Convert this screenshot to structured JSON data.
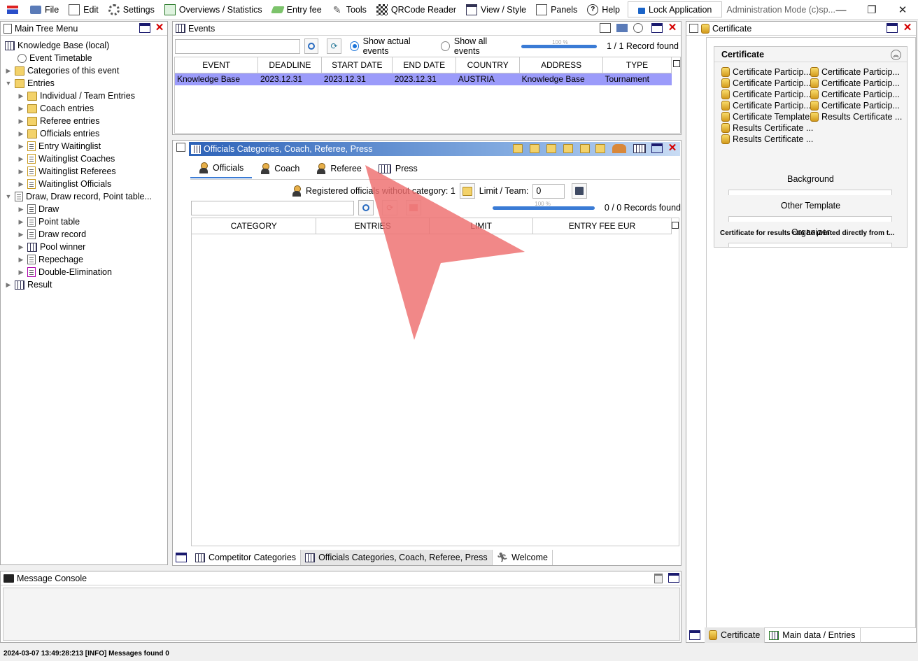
{
  "menubar": {
    "items": [
      "File",
      "Edit",
      "Settings",
      "Overviews / Statistics",
      "Entry fee",
      "Tools",
      "QRCode Reader",
      "View / Style",
      "Panels",
      "Help"
    ],
    "lock_label": "Lock Application",
    "admin_text": "Administration Mode (c)sp..."
  },
  "tree_panel": {
    "title": "Main Tree Menu",
    "items": [
      {
        "label": "Knowledge Base (local)"
      },
      {
        "label": "Event Timetable"
      },
      {
        "label": "Categories of this event"
      },
      {
        "label": "Entries"
      },
      {
        "label": "Individual / Team Entries"
      },
      {
        "label": "Coach entries"
      },
      {
        "label": "Referee entries"
      },
      {
        "label": "Officials entries"
      },
      {
        "label": "Entry Waitinglist"
      },
      {
        "label": "Waitinglist Coaches"
      },
      {
        "label": "Waitinglist Referees"
      },
      {
        "label": "Waitinglist Officials"
      },
      {
        "label": "Draw, Draw record, Point table..."
      },
      {
        "label": "Draw"
      },
      {
        "label": "Point table"
      },
      {
        "label": "Draw record"
      },
      {
        "label": "Pool winner"
      },
      {
        "label": "Repechage"
      },
      {
        "label": "Double-Elimination"
      },
      {
        "label": "Result"
      }
    ]
  },
  "events_panel": {
    "title": "Events",
    "search_value": "",
    "radio_actual": "Show actual events",
    "radio_all": "Show all events",
    "progress_text": "100 %",
    "progress": 1.0,
    "record_count": "1 / 1 Record found",
    "columns": [
      "EVENT",
      "DEADLINE",
      "START DATE",
      "END DATE",
      "COUNTRY",
      "ADDRESS",
      "TYPE"
    ],
    "rows": [
      [
        "Knowledge Base",
        "2023.12.31",
        "2023.12.31",
        "2023.12.31",
        "AUSTRIA",
        "Knowledge Base",
        "Tournament"
      ]
    ]
  },
  "officials_panel": {
    "title": "Officials Categories, Coach, Referee, Press",
    "tabs": [
      "Officials",
      "Coach",
      "Referee",
      "Press"
    ],
    "registered_text": "Registered officials without category: 1",
    "limit_label": "Limit / Team:",
    "limit_value": "0",
    "search_value": "",
    "progress_text": "100 %",
    "progress": 1.0,
    "record_count": "0 / 0 Records found",
    "columns": [
      "CATEGORY",
      "ENTRIES",
      "LIMIT",
      "ENTRY FEE EUR"
    ],
    "bottom_tabs": [
      "Competitor Categories",
      "Officials Categories, Coach, Referee, Press",
      "Welcome"
    ]
  },
  "certificate_panel": {
    "title": "Certificate",
    "section_title": "Certificate",
    "items_left": [
      "Certificate Particip...",
      "Certificate Particip...",
      "Certificate Particip...",
      "Certificate Particip...",
      "Certificate Template",
      "Results Certificate ...",
      "Results Certificate ..."
    ],
    "items_right": [
      "Certificate Particip...",
      "Certificate Particip...",
      "Certificate Particip...",
      "Certificate Particip...",
      "Results Certificate ..."
    ],
    "background_label": "Background",
    "other_label": "Other Template",
    "organizer_label": "Organizer",
    "footer_note": "Certificate for results can be printed directly from t...",
    "bottom_tabs": [
      "Certificate",
      "Main data / Entries"
    ]
  },
  "console": {
    "title": "Message Console"
  },
  "status": {
    "text": "2024-03-07 13:49:28:213 [INFO] Messages found 0"
  },
  "overlay": {
    "color": "#ee6e6e"
  }
}
